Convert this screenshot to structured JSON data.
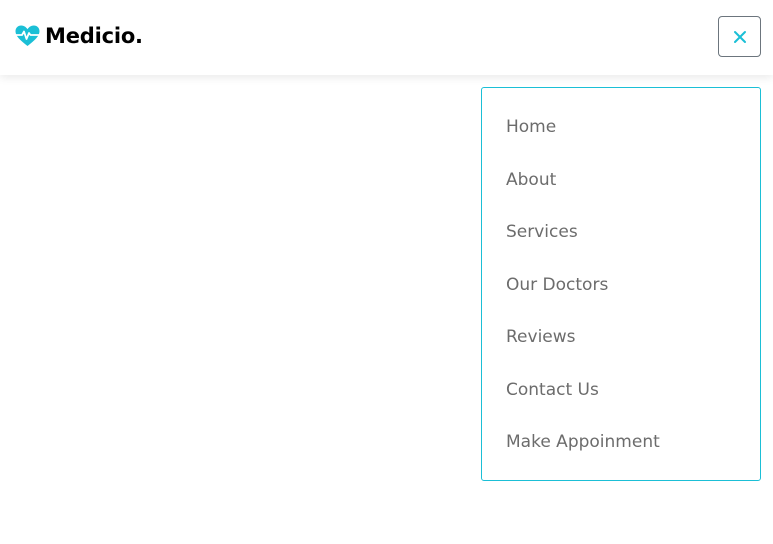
{
  "brand": {
    "name": "Medicio.",
    "icon": "heartbeat-icon",
    "accent_color": "#1bbfd6"
  },
  "header": {
    "toggle": {
      "icon": "close-icon",
      "state": "expanded"
    }
  },
  "nav": {
    "items": [
      {
        "label": "Home"
      },
      {
        "label": "About"
      },
      {
        "label": "Services"
      },
      {
        "label": "Our Doctors"
      },
      {
        "label": "Reviews"
      },
      {
        "label": "Contact Us"
      },
      {
        "label": "Make Appoinment"
      }
    ]
  }
}
